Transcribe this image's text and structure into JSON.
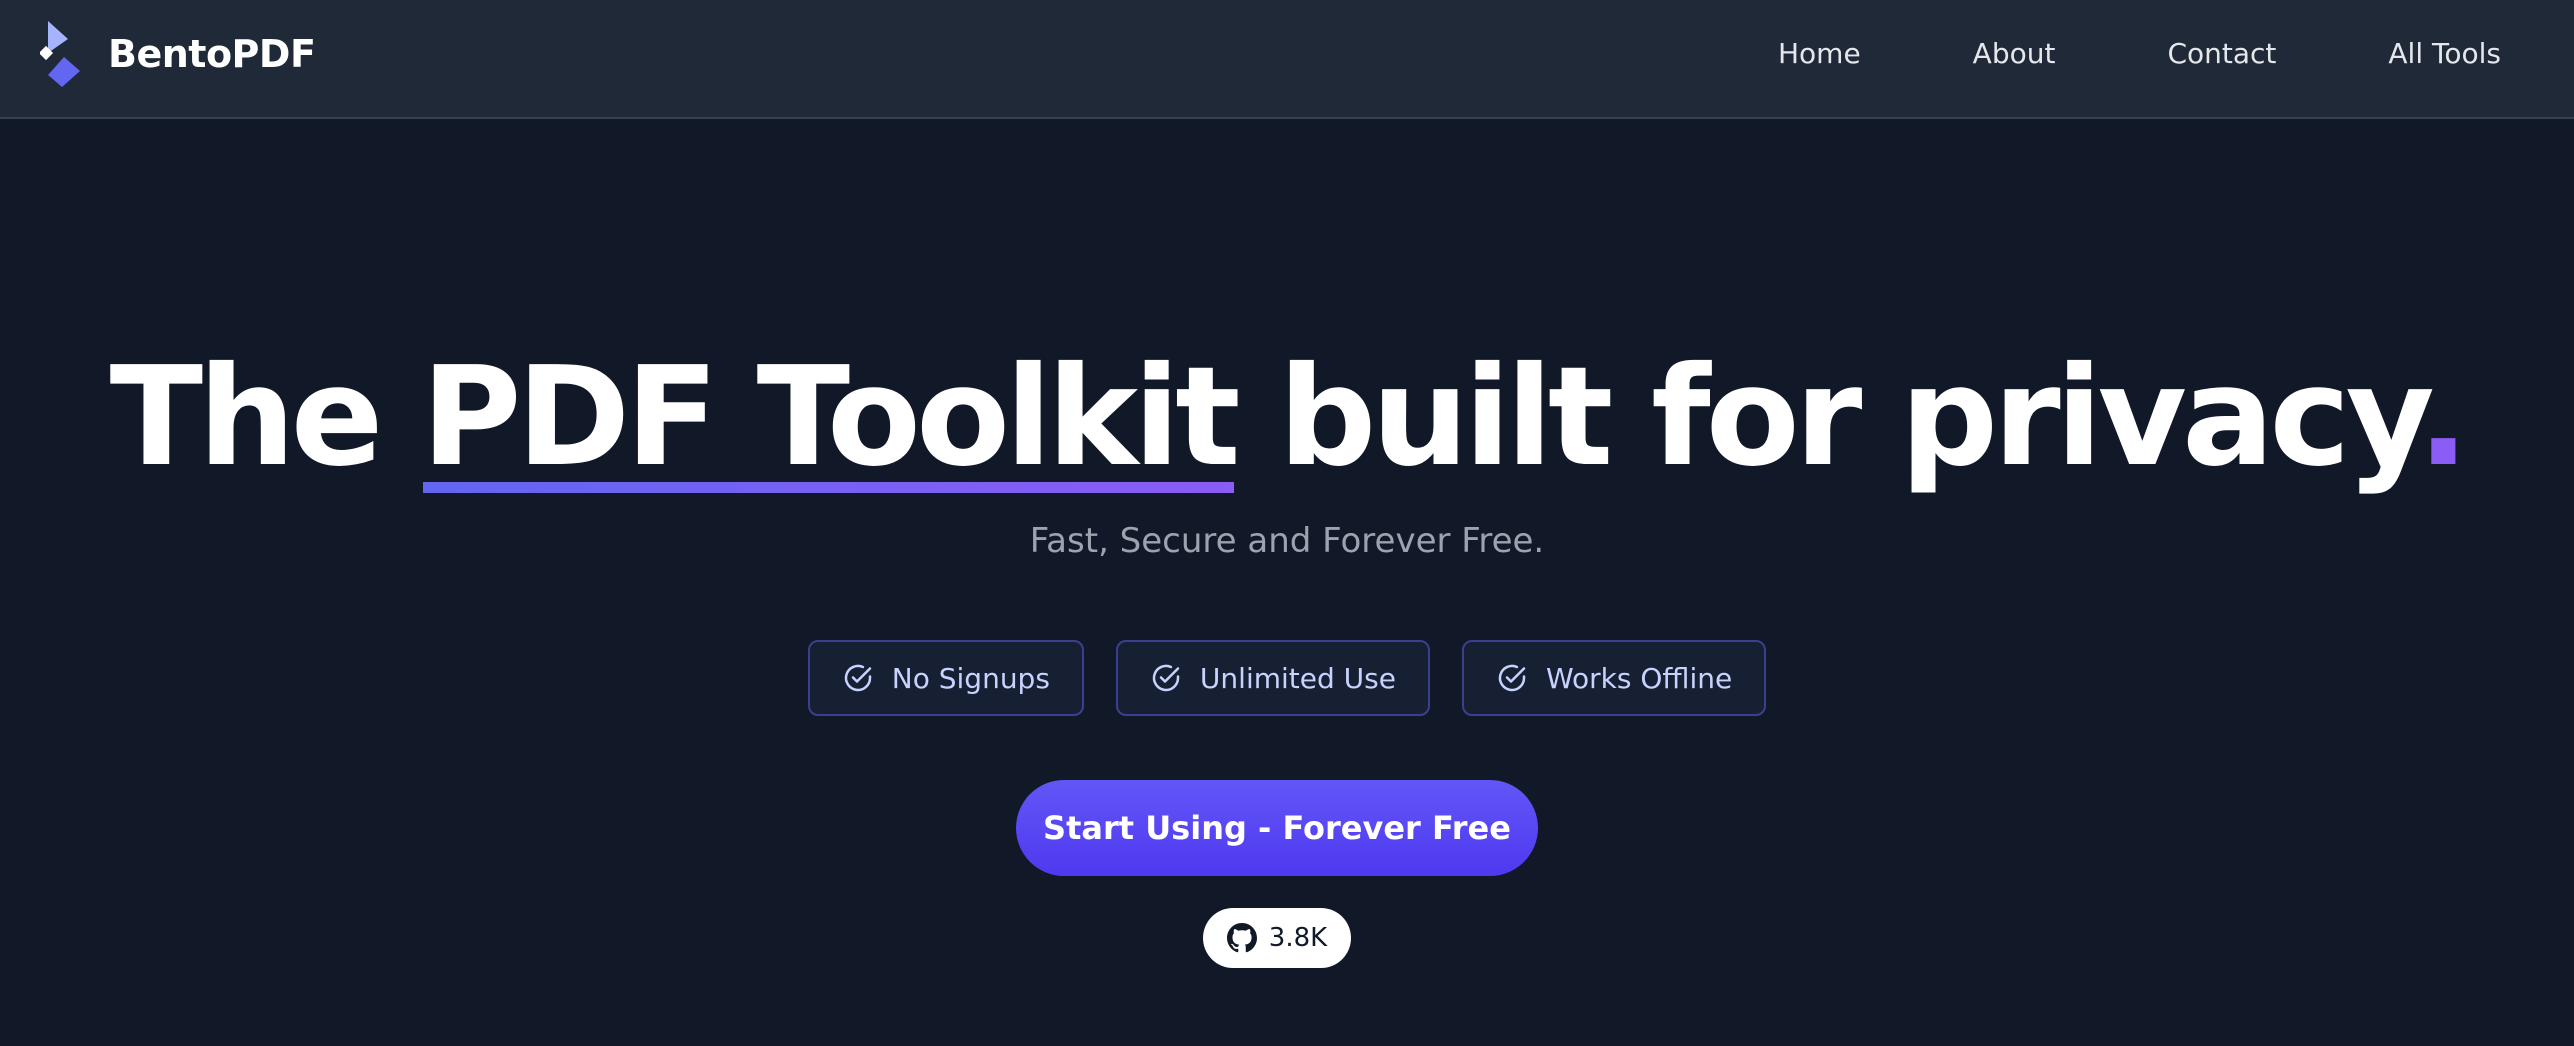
{
  "header": {
    "brand": "BentoPDF",
    "nav": [
      "Home",
      "About",
      "Contact",
      "All Tools"
    ]
  },
  "hero": {
    "title_before": "The ",
    "title_highlight": "PDF Toolkit",
    "title_after": " built for privacy",
    "title_dot": ".",
    "subtitle": "Fast, Secure and Forever Free.",
    "badges": [
      "No Signups",
      "Unlimited Use",
      "Works Offline"
    ],
    "cta_label": "Start Using - Forever Free",
    "github_count": "3.8K"
  },
  "colors": {
    "background": "#111827",
    "header_bg": "#1f2937",
    "accent": "#6366f1",
    "accent_purple": "#8b5cf6",
    "badge_text": "#c7d2fe"
  },
  "icons": {
    "brand": "bento-logo-icon",
    "badge": "check-circle-icon",
    "github": "github-icon"
  }
}
